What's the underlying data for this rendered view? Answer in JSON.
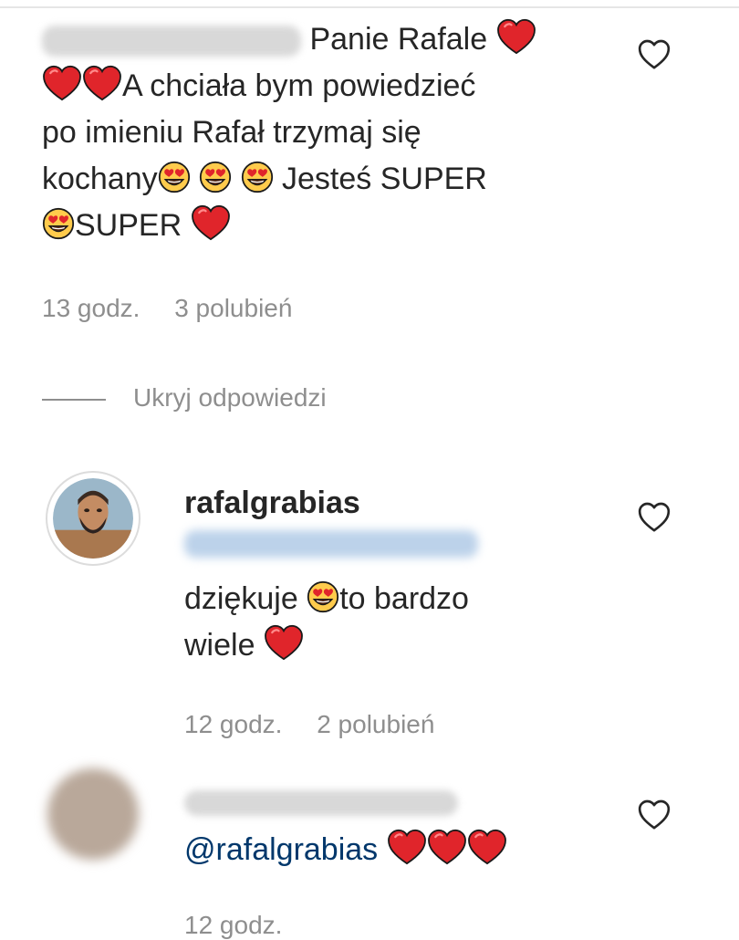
{
  "comment1": {
    "text_line1": "Panie Rafale",
    "text_line2": "A chciała bym powiedzieć",
    "text_line3": "po imieniu Rafał trzymaj się",
    "text_line4_a": "kochany",
    "text_line4_b": "Jesteś SUPER",
    "text_line5": "SUPER",
    "time": "13 godz.",
    "likes": "3 polubień"
  },
  "hide_replies": "Ukryj odpowiedzi",
  "reply1": {
    "username": "rafalgrabias",
    "text_line1_a": "dziękuje",
    "text_line1_b": "to bardzo",
    "text_line2": "wiele",
    "time": "12 godz.",
    "likes": "2 polubień"
  },
  "reply2": {
    "mention": "@rafalgrabias",
    "time": "12 godz."
  },
  "icons": {
    "like": "heart-outline-icon",
    "emoji": "heart-eyes-emoji-icon",
    "red_heart": "red-heart-emoji-icon"
  },
  "colors": {
    "text": "#262626",
    "meta": "#8e8e8e",
    "mention": "#00376b",
    "heart_red": "#e0252b",
    "emoji_yellow": "#ffcb4c"
  }
}
